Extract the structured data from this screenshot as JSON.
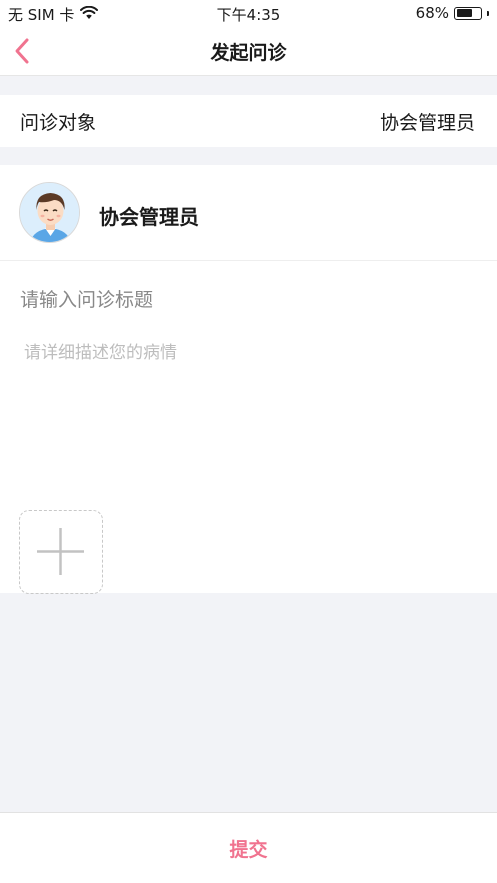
{
  "status_bar": {
    "carrier": "无 SIM 卡",
    "time": "下午4:35",
    "battery_percent": "68%",
    "battery_level": 0.68
  },
  "nav": {
    "title": "发起问诊",
    "accent_color": "#f0738f"
  },
  "consult_target": {
    "label": "问诊对象",
    "value": "协会管理员"
  },
  "user": {
    "name": "协会管理员"
  },
  "form": {
    "title_placeholder": "请输入问诊标题",
    "description_placeholder": "请详细描述您的病情"
  },
  "footer": {
    "submit_label": "提交"
  }
}
